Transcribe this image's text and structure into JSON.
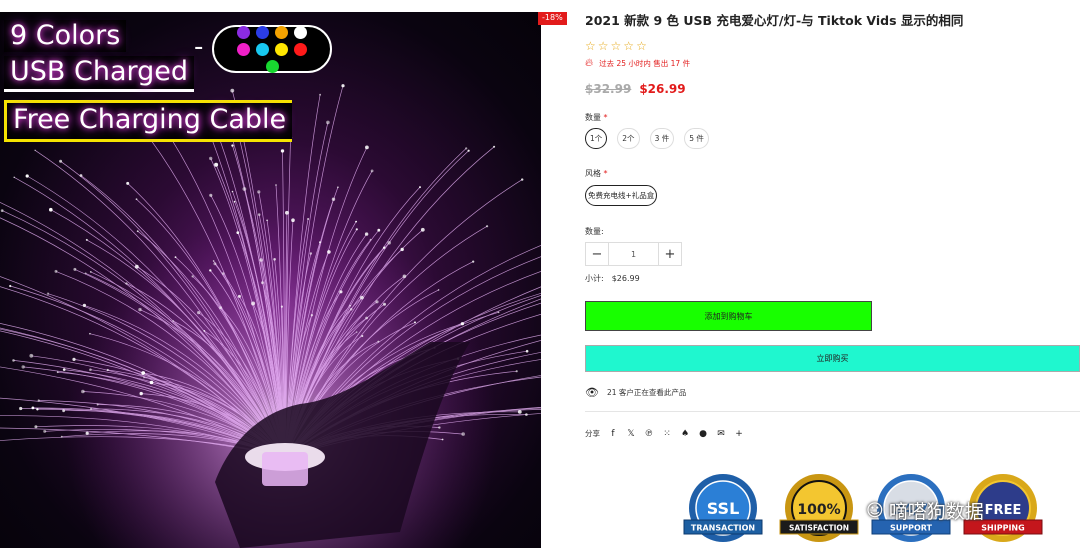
{
  "image": {
    "overlay_line1": "9 Colors",
    "overlay_line2": "USB Charged",
    "overlay_line3": "Free Charging Cable",
    "overlay_dash": "-",
    "swatch_colors": [
      "#8b2be2",
      "#2b3de8",
      "#f5a300",
      "#ffffff",
      "#f020c8",
      "#18c8f0",
      "#ffe600",
      "#ff1a1a",
      "#18d830"
    ],
    "discount_badge": "-18%"
  },
  "product": {
    "title": "2021 新款 9 色 USB 充电爱心灯/灯-与 Tiktok Vids 显示的相同",
    "rating_stars": 0,
    "sold_text": "过去 25 小时内 售出 17 件",
    "old_price": "$32.99",
    "new_price": "$26.99"
  },
  "options": {
    "quantity_label": "数量",
    "quantity_options": [
      "1个",
      "2个",
      "3 件",
      "5 件"
    ],
    "quantity_selected": "1个",
    "style_label": "风格",
    "style_value": "免费充电线+礼品盒",
    "required_mark": "*"
  },
  "purchase": {
    "qty_label": "数量:",
    "qty_minus": "−",
    "qty_value": "1",
    "qty_plus": "+",
    "subtotal_label": "小计:",
    "subtotal_value": "$26.99",
    "add_to_cart": "添加到购物车",
    "buy_now": "立即购买",
    "viewers_text": "21 客户正在查看此产品",
    "share_label": "分享",
    "colors": {
      "cart": "#18ff00",
      "buy": "#1ff7cf",
      "price": "#e21b1b"
    }
  },
  "badges": [
    {
      "top": "100% SECURE TRANSACTION",
      "main": "SSL",
      "ribbon": "TRANSACTION"
    },
    {
      "top": "GUARANTEED",
      "main": "100%",
      "ribbon": "SATISFACTION"
    },
    {
      "top": "24/7 SUPPORT",
      "main": "24/7",
      "ribbon": "SUPPORT"
    },
    {
      "top": "FREE SHIPPING",
      "main": "FREE",
      "ribbon": "SHIPPING"
    }
  ],
  "watermark": "嘀嗒狗数据"
}
